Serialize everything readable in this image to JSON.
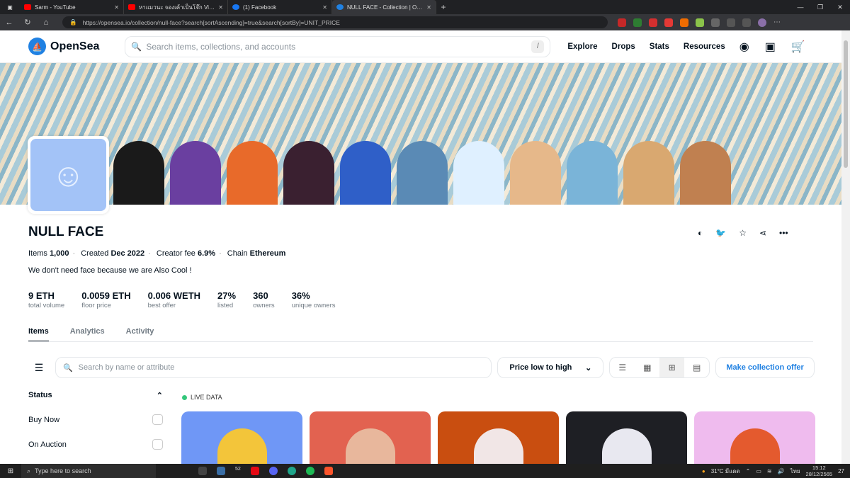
{
  "browser": {
    "tabs": [
      {
        "title": "Sarm - YouTube",
        "color": "#ff0000"
      },
      {
        "title": "หาแมวนะ จองเค้าเป็นโจ๊ก Vicky + อะ",
        "color": "#ff0000"
      },
      {
        "title": "(1) Facebook",
        "color": "#1877f2"
      },
      {
        "title": "NULL FACE - Collection | OpenSe",
        "color": "#2081e2"
      }
    ],
    "url": "https://opensea.io/collection/null-face?search[sortAscending]=true&search[sortBy]=UNIT_PRICE"
  },
  "header": {
    "brand": "OpenSea",
    "search_placeholder": "Search items, collections, and accounts",
    "search_shortcut": "/",
    "nav": [
      "Explore",
      "Drops",
      "Stats",
      "Resources"
    ]
  },
  "collection": {
    "name": "NULL FACE",
    "items_label": "Items",
    "items_value": "1,000",
    "created_label": "Created",
    "created_value": "Dec 2022",
    "fee_label": "Creator fee",
    "fee_value": "6.9%",
    "chain_label": "Chain",
    "chain_value": "Ethereum",
    "description": "We don't need face because we are Also Cool !"
  },
  "stats": [
    {
      "value": "9 ETH",
      "label": "total volume"
    },
    {
      "value": "0.0059 ETH",
      "label": "floor price"
    },
    {
      "value": "0.006 WETH",
      "label": "best offer"
    },
    {
      "value": "27%",
      "label": "listed"
    },
    {
      "value": "360",
      "label": "owners"
    },
    {
      "value": "36%",
      "label": "unique owners"
    }
  ],
  "tabs": [
    "Items",
    "Analytics",
    "Activity"
  ],
  "toolbar": {
    "search_placeholder": "Search by name or attribute",
    "sort": "Price low to high",
    "offer_button": "Make collection offer"
  },
  "sidebar": {
    "status_title": "Status",
    "options": [
      "Buy Now",
      "On Auction"
    ]
  },
  "live_label": "LIVE DATA",
  "cards": [
    {
      "bg": "#6f97f6",
      "fig": "#f3c53a"
    },
    {
      "bg": "#e26250",
      "fig": "#e8b79c"
    },
    {
      "bg": "#c94e10",
      "fig": "#f1e6e6"
    },
    {
      "bg": "#1e1f24",
      "fig": "#e8e8f0"
    },
    {
      "bg": "#efbbee",
      "fig": "#e45a2e"
    }
  ],
  "taskbar": {
    "search_placeholder": "Type here to search",
    "weather": "31°C มีแดด",
    "lang": "ไทย",
    "time": "15:12",
    "date": "28/12/2565",
    "badge": "52",
    "notif": "27"
  }
}
